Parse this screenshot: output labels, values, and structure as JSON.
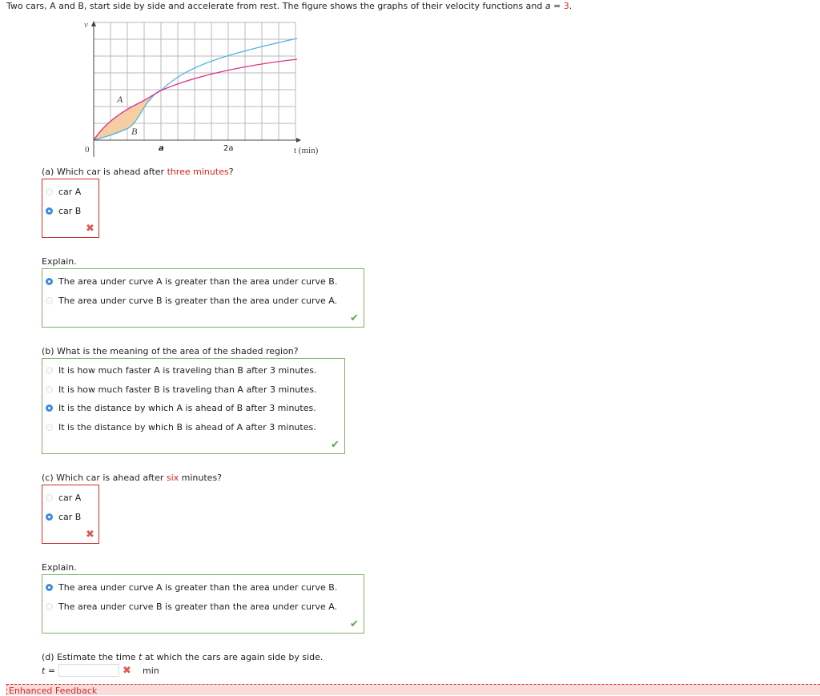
{
  "intro": {
    "text": "Two cars, A and B, start side by side and accelerate from rest. The figure shows the graphs of their velocity functions and ",
    "var": "a",
    "eq": " = ",
    "value": "3",
    "end": "."
  },
  "figure": {
    "y_axis_label": "v",
    "x_axis_label": "t (min)",
    "origin_label": "0",
    "tick_a": "a",
    "tick_2a": "2a",
    "curve_a_label": "A",
    "curve_b_label": "B",
    "colors": {
      "curve_a": "#d9338f",
      "curve_b": "#4fb3e0",
      "shaded": "#f5cfa3",
      "grid": "#b8b8b8"
    }
  },
  "part_a": {
    "question_pre": "(a) Which car is ahead after ",
    "question_highlight": "three minutes",
    "question_post": "?",
    "options": [
      {
        "label": "car A",
        "selected": false
      },
      {
        "label": "car B",
        "selected": true
      }
    ],
    "status": "incorrect",
    "explain_label": "Explain.",
    "explain_options": [
      {
        "label": "The area under curve A is greater than the area under curve B.",
        "selected": true
      },
      {
        "label": "The area under curve B is greater than the area under curve A.",
        "selected": false
      }
    ],
    "explain_status": "correct"
  },
  "part_b": {
    "question": "(b) What is the meaning of the area of the shaded region?",
    "options": [
      {
        "label": "It is how much faster A is traveling than B after 3 minutes.",
        "selected": false
      },
      {
        "label": "It is how much faster B is traveling than A after 3 minutes.",
        "selected": false
      },
      {
        "label": "It is the distance by which A is ahead of B after 3 minutes.",
        "selected": true
      },
      {
        "label": "It is the distance by which B is ahead of A after 3 minutes.",
        "selected": false
      }
    ],
    "status": "correct"
  },
  "part_c": {
    "question_pre": "(c) Which car is ahead after ",
    "question_highlight": "six",
    "question_post": " minutes?",
    "options": [
      {
        "label": "car A",
        "selected": false
      },
      {
        "label": "car B",
        "selected": true
      }
    ],
    "status": "incorrect",
    "explain_label": "Explain.",
    "explain_options": [
      {
        "label": "The area under curve A is greater than the area under curve B.",
        "selected": true
      },
      {
        "label": "The area under curve B is greater than the area under curve A.",
        "selected": false
      }
    ],
    "explain_status": "correct"
  },
  "part_d": {
    "question_pre": "(d) Estimate the time ",
    "question_var": "t",
    "question_post": " at which the cars are again side by side.",
    "input_label_var": "t",
    "input_label_eq": " =",
    "input_value": "",
    "unit": "min",
    "status": "incorrect"
  },
  "feedback": {
    "label": "Enhanced Feedback"
  },
  "icons": {
    "incorrect": "✖",
    "correct": "✔"
  }
}
